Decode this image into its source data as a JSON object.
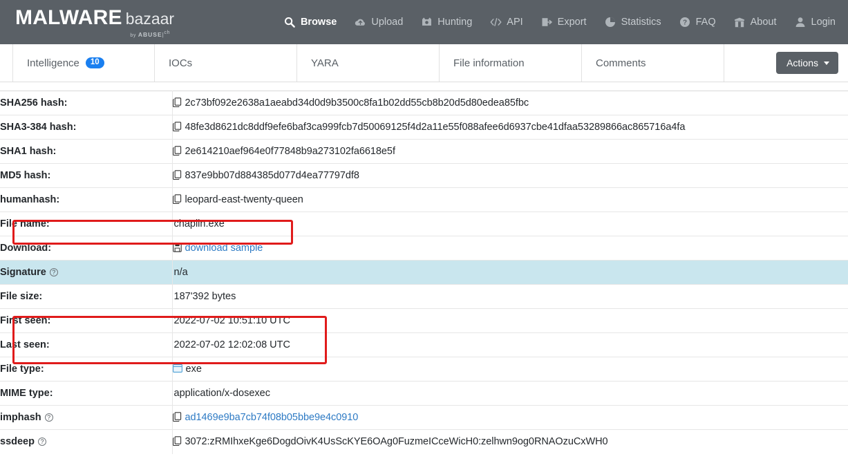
{
  "brand": {
    "name_bold": "MALWARE",
    "name_light": "bazaar",
    "by": "by",
    "abuse": "ABUSE",
    "ch": "ch"
  },
  "nav": {
    "items": [
      {
        "label": "Browse",
        "icon": "search-icon",
        "active": true
      },
      {
        "label": "Upload",
        "icon": "cloud-upload-icon",
        "active": false
      },
      {
        "label": "Hunting",
        "icon": "crosshair-icon",
        "active": false
      },
      {
        "label": "API",
        "icon": "code-icon",
        "active": false
      },
      {
        "label": "Export",
        "icon": "export-icon",
        "active": false
      },
      {
        "label": "Statistics",
        "icon": "pie-chart-icon",
        "active": false
      },
      {
        "label": "FAQ",
        "icon": "question-circle-icon",
        "active": false
      },
      {
        "label": "About",
        "icon": "bank-icon",
        "active": false
      },
      {
        "label": "Login",
        "icon": "user-icon",
        "active": false
      }
    ]
  },
  "tabs": {
    "items": [
      {
        "label": "Intelligence",
        "badge": "10"
      },
      {
        "label": "IOCs",
        "badge": ""
      },
      {
        "label": "YARA",
        "badge": ""
      },
      {
        "label": "File information",
        "badge": ""
      },
      {
        "label": "Comments",
        "badge": ""
      }
    ],
    "actions_label": "Actions"
  },
  "file_info": {
    "rows": [
      {
        "key": "SHA256 hash:",
        "value": "2c73bf092e2638a1aeabd34d0d9b3500c8fa1b02dd55cb8b20d5d80edea85fbc",
        "copy": true
      },
      {
        "key": "SHA3-384 hash:",
        "value": "48fe3d8621dc8ddf9efe6baf3ca999fcb7d50069125f4d2a11e55f088afee6d6937cbe41dfaa53289866ac865716a4fa",
        "copy": true
      },
      {
        "key": "SHA1 hash:",
        "value": "2e614210aef964e0f77848b9a273102fa6618e5f",
        "copy": true
      },
      {
        "key": "MD5 hash:",
        "value": "837e9bb07d884385d077d4ea77797df8",
        "copy": true
      },
      {
        "key": "humanhash:",
        "value": "leopard-east-twenty-queen",
        "copy": true
      },
      {
        "key": "File name:",
        "value": "chaplin.exe",
        "copy": false
      },
      {
        "key": "Download:",
        "value": "download sample",
        "copy": false,
        "link": true,
        "icon": "save-icon"
      },
      {
        "key": "Signature",
        "value": "n/a",
        "copy": false,
        "help": true,
        "highlight": true
      },
      {
        "key": "File size:",
        "value": "187'392 bytes",
        "copy": false
      },
      {
        "key": "First seen:",
        "value": "2022-07-02 10:51:10 UTC",
        "copy": false
      },
      {
        "key": "Last seen:",
        "value": "2022-07-02 12:02:08 UTC",
        "copy": false
      },
      {
        "key": "File type:",
        "value": "exe",
        "copy": false,
        "icon": "file-icon"
      },
      {
        "key": "MIME type:",
        "value": "application/x-dosexec",
        "copy": false
      },
      {
        "key": "imphash",
        "value": "ad1469e9ba7cb74f08b05bbe9e4c0910",
        "copy": true,
        "help": true,
        "link": true
      },
      {
        "key": "ssdeep",
        "value": "3072:zRMIhxeKge6DogdOivK4UsScKYE6OAg0FuzmeICceWicH0:zelhwn9og0RNAOzuCxWH0",
        "copy": true,
        "help": true
      }
    ]
  },
  "annotations": {
    "box1_target": "File name row",
    "box2_target": "First seen and Last seen rows",
    "color": "#e01b1b"
  },
  "colors": {
    "navbar_bg": "#5a6066",
    "badge_blue": "#1a7ff0",
    "link_blue": "#2d7ac4",
    "signature_row_bg": "#c9e6ee",
    "annotation_red": "#e01b1b"
  }
}
